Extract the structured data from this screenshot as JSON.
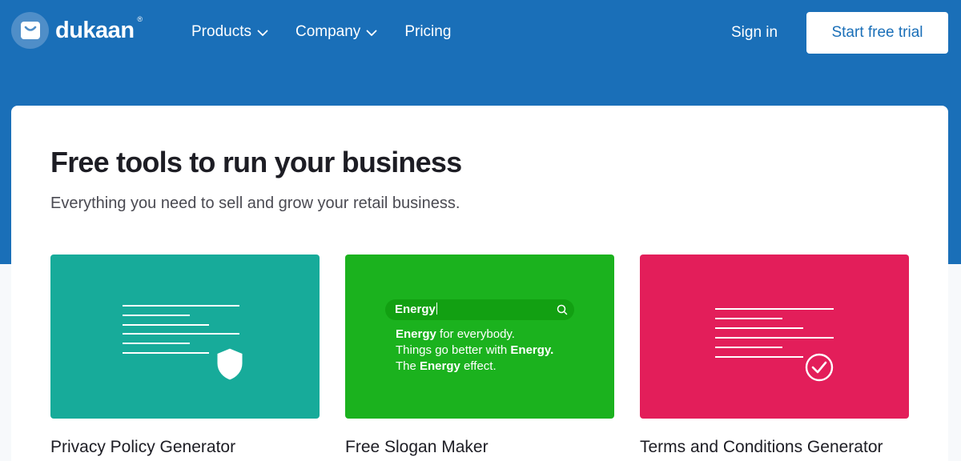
{
  "brand": {
    "name": "dukaan",
    "registered_mark": "®"
  },
  "nav": {
    "items": [
      {
        "label": "Products",
        "has_dropdown": true
      },
      {
        "label": "Company",
        "has_dropdown": true
      },
      {
        "label": "Pricing",
        "has_dropdown": false
      }
    ],
    "sign_in": "Sign in",
    "cta": "Start free trial"
  },
  "hero": {
    "title": "Free tools to run your business",
    "subtitle": "Everything you need to sell and grow your retail business."
  },
  "tools": [
    {
      "label": "Privacy Policy Generator",
      "color": "#17ab9a",
      "icon": "shield-icon"
    },
    {
      "label": "Free Slogan Maker",
      "color": "#1bb21e",
      "icon": "search-icon"
    },
    {
      "label": "Terms and Conditions Generator",
      "color": "#e31e5a",
      "icon": "check-circle-icon"
    }
  ],
  "slogan_demo": {
    "query": "Energy",
    "line1_bold": "Energy",
    "line1_rest": " for everybody.",
    "line2_rest": "Things go better with ",
    "line2_bold": "Energy.",
    "line3_pre": "The ",
    "line3_bold": "Energy",
    "line3_rest": " effect."
  },
  "colors": {
    "header_bg": "#1a6fb8",
    "accent": "#1a6fb8"
  }
}
